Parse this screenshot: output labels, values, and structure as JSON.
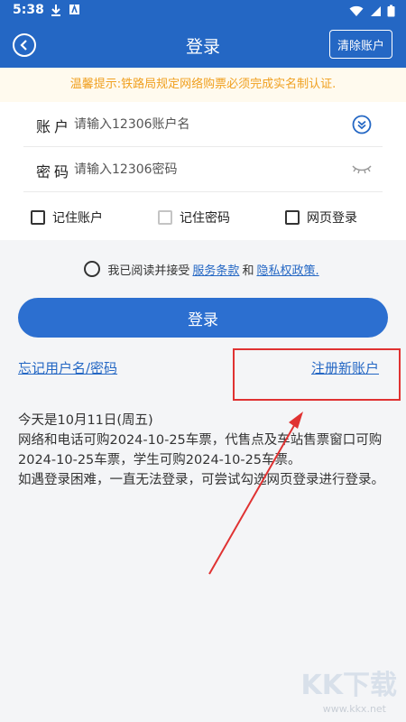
{
  "status_bar": {
    "time": "5:38"
  },
  "header": {
    "title": "登录",
    "clear_label": "清除账户"
  },
  "notice": "温馨提示:铁路局规定网络购票必须完成实名制认证.",
  "form": {
    "account_label": "账户",
    "account_placeholder": "请输入12306账户名",
    "password_label": "密码",
    "password_placeholder": "请输入12306密码",
    "remember_account": "记住账户",
    "remember_password": "记住密码",
    "web_login": "网页登录"
  },
  "agreement": {
    "prefix": "我已阅读并接受",
    "terms": "服务条款",
    "and": "和",
    "privacy": "隐私权政策."
  },
  "login_button": "登录",
  "links": {
    "forgot": "忘记用户名/密码",
    "register": "注册新账户"
  },
  "info_lines": [
    "今天是10月11日(周五)",
    "网络和电话可购2024-10-25车票，代售点及车站售票窗口可购2024-10-25车票，学生可购2024-10-25车票。",
    "如遇登录困难，一直无法登录，可尝试勾选网页登录进行登录。"
  ],
  "watermark": {
    "text": "KK下载",
    "url": "www.kkx.net"
  },
  "colors": {
    "primary": "#2467c4",
    "notice_text": "#f0a020",
    "highlight": "#e03232"
  }
}
